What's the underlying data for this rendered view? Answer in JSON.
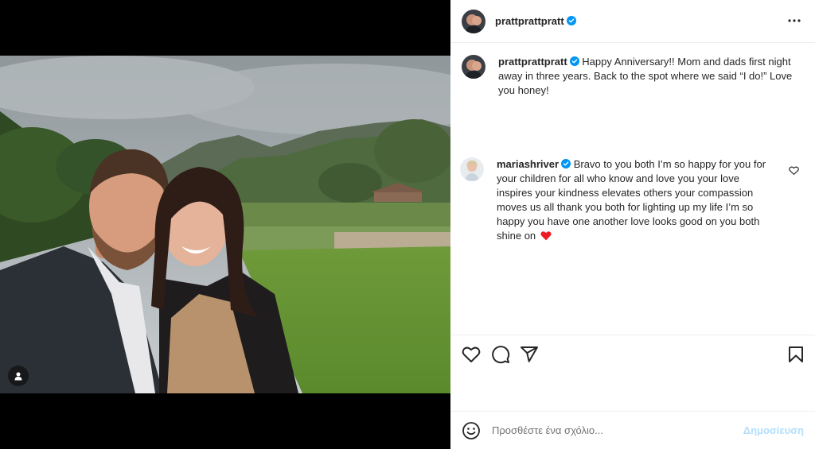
{
  "post": {
    "author": "prattprattpratt",
    "author_verified": true,
    "caption_user": "prattprattpratt",
    "caption_text": "Happy Anniversary!! Mom and dads first night away in three years. Back to the spot where we said “I do!” Love you honey!",
    "image_alt": "Selfie of a couple in front of a garden lawn and mountains"
  },
  "comments": [
    {
      "user": "mariashriver",
      "verified": true,
      "text": "Bravo to you both I’m so happy for you for your children for all who know and love you your love inspires your kindness elevates others your compassion moves us all thank you both for lighting up my life I’m so happy you have one another love looks good on you both shine on"
    }
  ],
  "add_comment": {
    "placeholder": "Προσθέστε ένα σχόλιο...",
    "post_label": "Δημοσίευση"
  },
  "icons": {
    "more": "more-options-icon",
    "like": "heart-icon",
    "comment": "comment-bubble-icon",
    "share": "paper-plane-icon",
    "save": "bookmark-icon",
    "emoji": "smiley-icon",
    "tagged_user": "user-tag-icon",
    "verified": "verified-badge-icon",
    "comment_emoji": "red-heart-icon"
  },
  "colors": {
    "verified_blue": "#0095f6",
    "post_button_disabled": "#b2dffc",
    "heart_red": "#ed1c24"
  }
}
